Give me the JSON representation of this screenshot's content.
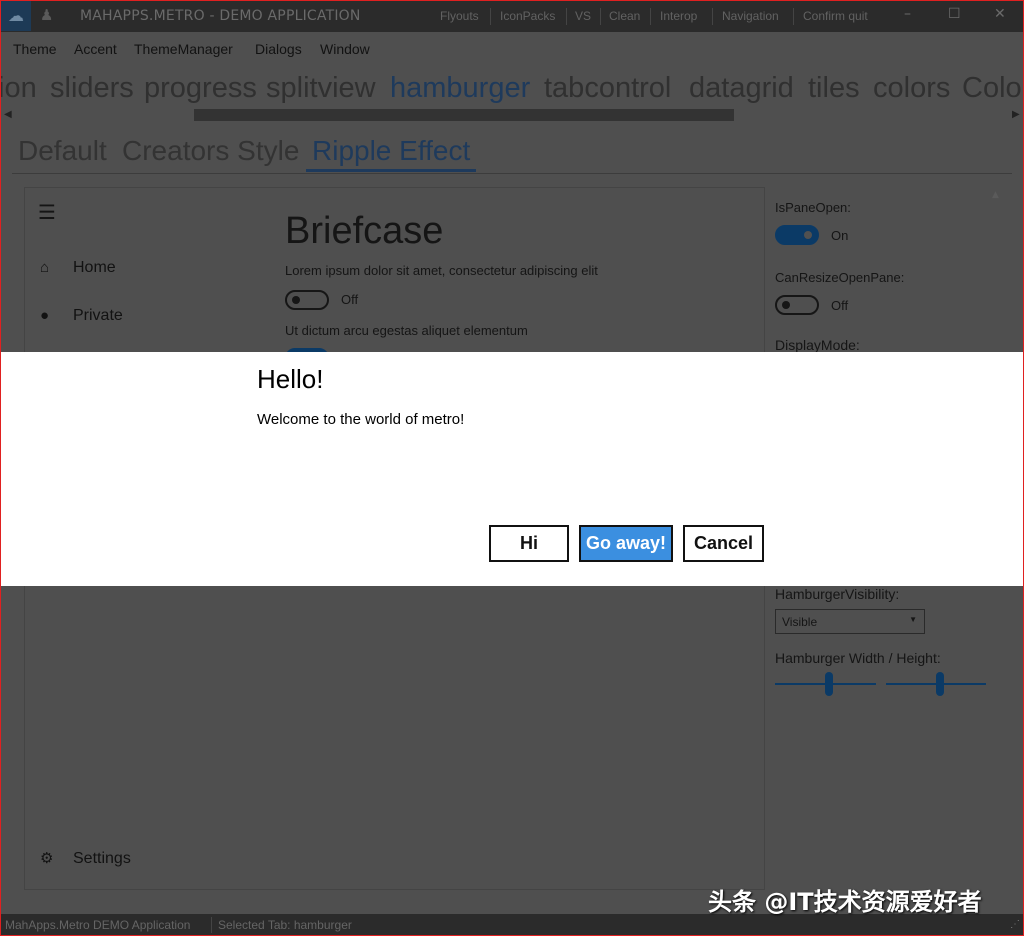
{
  "window": {
    "title": "MAHAPPS.METRO - DEMO APPLICATION",
    "commands": [
      "Flyouts",
      "IconPacks",
      "VS",
      "Clean",
      "Interop",
      "Navigation",
      "Confirm quit"
    ]
  },
  "menu": [
    "Theme",
    "Accent",
    "ThemeManager",
    "Dialogs",
    "Window"
  ],
  "tabs": {
    "items": [
      "ion",
      "sliders",
      "progress",
      "splitview",
      "hamburger",
      "tabcontrol",
      "datagrid",
      "tiles",
      "colors",
      "Colo"
    ],
    "selected": "hamburger"
  },
  "subtabs": {
    "items": [
      "Default",
      "Creators Style",
      "Ripple Effect"
    ],
    "selected": "Ripple Effect"
  },
  "hamburger": {
    "items": [
      "Home",
      "Private"
    ],
    "settings": "Settings"
  },
  "content": {
    "title": "Briefcase",
    "line1": "Lorem ipsum dolor sit amet, consectetur adipiscing elit",
    "toggle1": "Off",
    "line2": "Ut dictum arcu egestas aliquet elementum"
  },
  "options": {
    "is_pane_open_label": "IsPaneOpen:",
    "is_pane_open": "On",
    "can_resize_label": "CanResizeOpenPane:",
    "can_resize": "Off",
    "display_mode_label": "DisplayMode:",
    "visibility_label": "HamburgerVisibility:",
    "visibility_value": "Visible",
    "size_label": "Hamburger Width / Height:",
    "width_slider": 0.5,
    "height_slider": 0.5
  },
  "dialog": {
    "title": "Hello!",
    "message": "Welcome to the world of metro!",
    "buttons": {
      "hi": "Hi",
      "go_away": "Go away!",
      "cancel": "Cancel"
    }
  },
  "status": {
    "app": "MahApps.Metro DEMO Application",
    "selected_tab": "Selected Tab:  hamburger"
  },
  "watermark": "头条 @IT技术资源爱好者",
  "colors": {
    "accent": "#3b8fe0",
    "toggle_on": "#0b3a66",
    "border": "#e02020"
  }
}
